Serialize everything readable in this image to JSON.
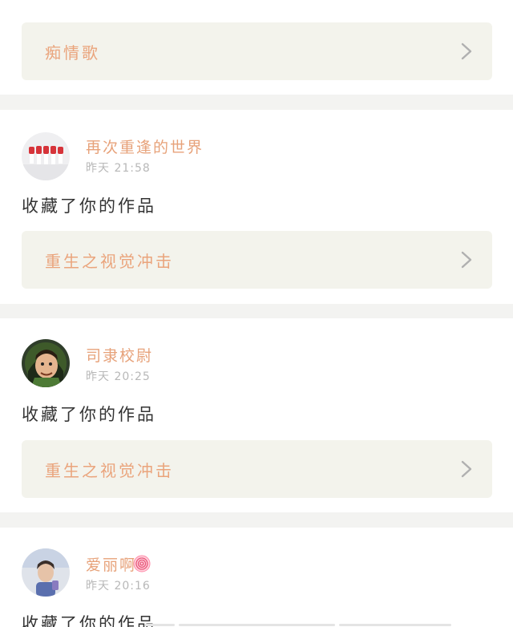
{
  "feed": [
    {
      "username": "",
      "time": "",
      "action": "",
      "work_title": "痴情歌"
    },
    {
      "username": "再次重逢的世界",
      "time": "昨天 21:58",
      "action": "收藏了你的作品",
      "work_title": "重生之视觉冲击"
    },
    {
      "username": "司隶校尉",
      "time": "昨天 20:25",
      "action": "收藏了你的作品",
      "work_title": "重生之视觉冲击"
    },
    {
      "username": "爱丽啊",
      "username_emoji": "swirl-lollipop-icon",
      "time": "昨天 20:16",
      "action": "收藏了你的作品"
    }
  ],
  "colors": {
    "username": "#e7a27a",
    "work_title": "#eaa47c",
    "time": "#b8b8b8",
    "action": "#333333",
    "work_box_bg": "#f3f3ec",
    "page_bg": "#f3f3f1",
    "card_bg": "#ffffff"
  }
}
